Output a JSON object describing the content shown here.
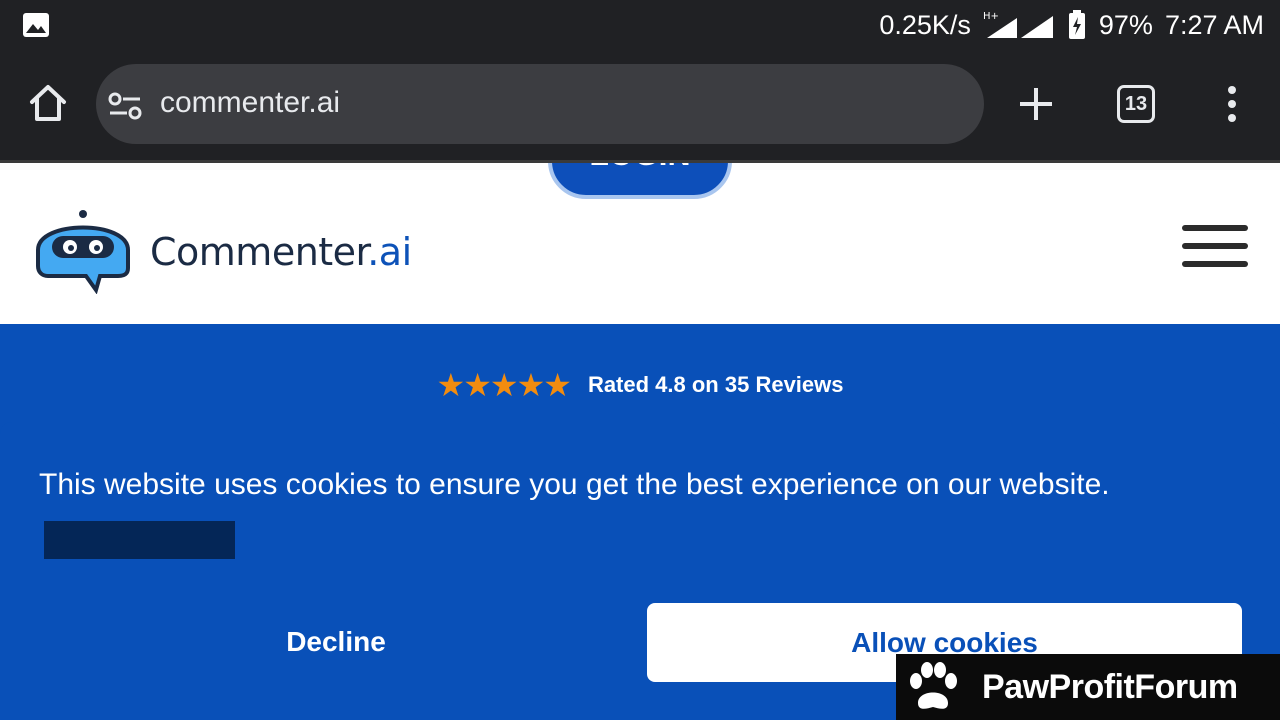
{
  "status_bar": {
    "network_speed": "0.25K/s",
    "network_type": "H+",
    "battery": "97%",
    "time": "7:27 AM",
    "icons": [
      "gallery-icon",
      "signal-icon",
      "battery-charging-icon"
    ]
  },
  "browser": {
    "url": "commenter.ai",
    "tab_count": "13",
    "icons": [
      "home-icon",
      "site-settings-icon",
      "plus-icon",
      "tabs-icon",
      "menu-icon"
    ]
  },
  "site": {
    "login_label": "LOGIN",
    "brand_main": "Commenter",
    "brand_suffix": ".ai",
    "rating_stars": "★★★★★",
    "rating_text": "Rated 4.8 on 35 Reviews",
    "accent_color": "#0950b8",
    "star_color": "#f28c0f"
  },
  "cookie_banner": {
    "message": "This website uses cookies to ensure you get the best experience on our website.",
    "decline_label": "Decline",
    "allow_label": "Allow cookies"
  },
  "watermark": {
    "text": "PawProfitForum"
  }
}
